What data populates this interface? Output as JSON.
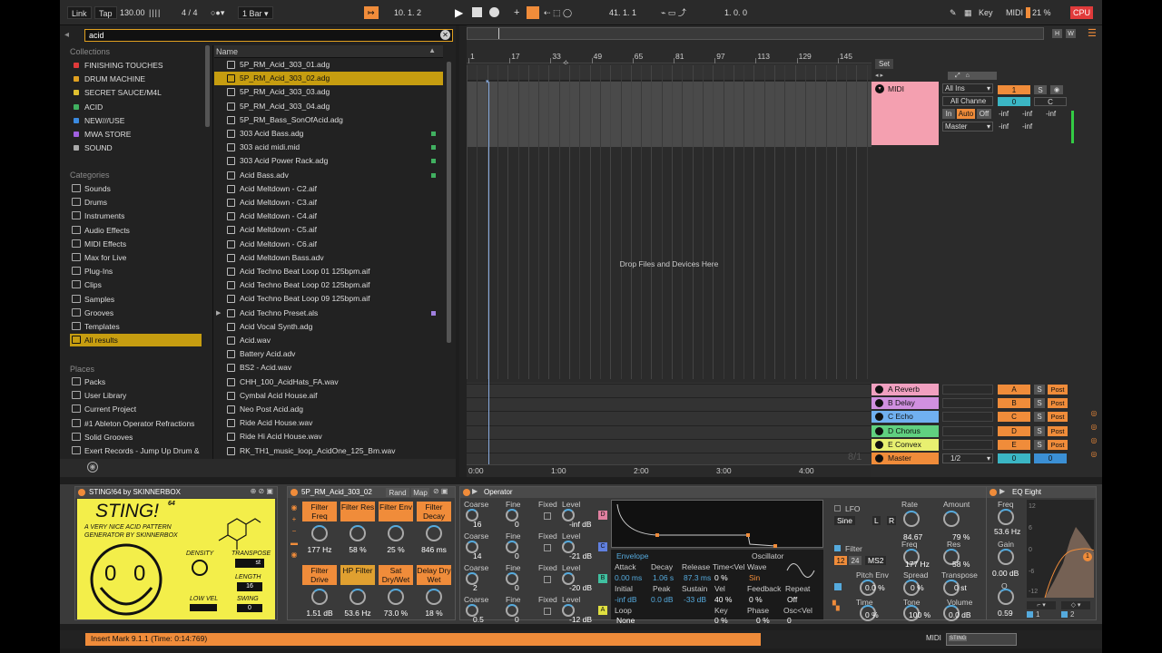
{
  "transport": {
    "link": "Link",
    "tap": "Tap",
    "tempo": "130.00",
    "signature": "4 / 4",
    "quantize": "1 Bar",
    "position": "10.  1.  2",
    "loop_start": "41.  1.  1",
    "loop_length": "1.  0.  0",
    "key": "Key",
    "midi": "MIDI",
    "cpu_value": "21 %",
    "cpu": "CPU"
  },
  "browser": {
    "search_value": "acid",
    "collections_header": "Collections",
    "collections": [
      {
        "label": "FINISHING TOUCHES",
        "color": "#e03a3a"
      },
      {
        "label": "DRUM MACHINE",
        "color": "#e0a020"
      },
      {
        "label": "SECRET SAUCE/M4L",
        "color": "#e0c030"
      },
      {
        "label": "ACID",
        "color": "#40b060"
      },
      {
        "label": "NEW///USE",
        "color": "#3a8ae0"
      },
      {
        "label": "MWA STORE",
        "color": "#a060e0"
      },
      {
        "label": "SOUND",
        "color": "#aaaaaa"
      }
    ],
    "categories_header": "Categories",
    "categories": [
      "Sounds",
      "Drums",
      "Instruments",
      "Audio Effects",
      "MIDI Effects",
      "Max for Live",
      "Plug-Ins",
      "Clips",
      "Samples",
      "Grooves",
      "Templates",
      "All results"
    ],
    "places_header": "Places",
    "places": [
      "Packs",
      "User Library",
      "Current Project",
      "#1 Ableton Operator Refractions",
      "Solid Grooves",
      "Exert Records - Jump Up Drum &"
    ],
    "column_name": "Name",
    "files": [
      {
        "name": "5P_RM_Acid_303_01.adg",
        "tag": ""
      },
      {
        "name": "5P_RM_Acid_303_02.adg",
        "tag": ""
      },
      {
        "name": "5P_RM_Acid_303_03.adg",
        "tag": ""
      },
      {
        "name": "5P_RM_Acid_303_04.adg",
        "tag": ""
      },
      {
        "name": "5P_RM_Bass_SonOfAcid.adg",
        "tag": ""
      },
      {
        "name": "303 Acid Bass.adg",
        "tag": "#40b060"
      },
      {
        "name": "303 acid midi.mid",
        "tag": "#40b060"
      },
      {
        "name": "303 Acid Power Rack.adg",
        "tag": "#40b060"
      },
      {
        "name": "Acid Bass.adv",
        "tag": "#40b060"
      },
      {
        "name": "Acid Meltdown - C2.aif",
        "tag": ""
      },
      {
        "name": "Acid Meltdown - C3.aif",
        "tag": ""
      },
      {
        "name": "Acid Meltdown - C4.aif",
        "tag": ""
      },
      {
        "name": "Acid Meltdown - C5.aif",
        "tag": ""
      },
      {
        "name": "Acid Meltdown - C6.aif",
        "tag": ""
      },
      {
        "name": "Acid Meltdown Bass.adv",
        "tag": ""
      },
      {
        "name": "Acid Techno Beat Loop 01 125bpm.aif",
        "tag": ""
      },
      {
        "name": "Acid Techno Beat Loop 02 125bpm.aif",
        "tag": ""
      },
      {
        "name": "Acid Techno Beat Loop 09 125bpm.aif",
        "tag": ""
      },
      {
        "name": "Acid Techno Preset.als",
        "tag": "#a080e0"
      },
      {
        "name": "Acid Vocal Synth.adg",
        "tag": ""
      },
      {
        "name": "Acid.wav",
        "tag": ""
      },
      {
        "name": "Battery Acid.adv",
        "tag": ""
      },
      {
        "name": "BS2 - Acid.wav",
        "tag": ""
      },
      {
        "name": "CHH_100_AcidHats_FA.wav",
        "tag": ""
      },
      {
        "name": "Cymbal Acid House.aif",
        "tag": ""
      },
      {
        "name": "Neo Post Acid.adg",
        "tag": ""
      },
      {
        "name": "Ride Acid House.wav",
        "tag": ""
      },
      {
        "name": "Ride Hi Acid House.wav",
        "tag": ""
      },
      {
        "name": "RK_TH1_music_loop_AcidOne_125_Bm.wav",
        "tag": ""
      }
    ]
  },
  "arrangement": {
    "bars": [
      "1",
      "17",
      "33",
      "49",
      "65",
      "81",
      "97",
      "113",
      "129",
      "145"
    ],
    "drop_text": "Drop Files and Devices Here",
    "set_label": "Set",
    "times": [
      "0:00",
      "1:00",
      "2:00",
      "3:00",
      "4:00"
    ],
    "zoom": "8/1"
  },
  "mixer": {
    "midi_track": {
      "name": "MIDI",
      "input": "All Ins",
      "channel": "All Channe",
      "monitor_in": "In",
      "monitor_auto": "Auto",
      "monitor_off": "Off",
      "output": "Master",
      "number": "1",
      "solo": "S",
      "volume": "0",
      "pan": "C",
      "inf1": "-inf",
      "inf2": "-inf",
      "inf3": "-inf",
      "inf4": "-inf",
      "inf5": "-inf"
    },
    "returns": [
      {
        "name": "A Reverb",
        "letter": "A",
        "color": "#f0a0c0"
      },
      {
        "name": "B Delay",
        "letter": "B",
        "color": "#d090e0"
      },
      {
        "name": "C Echo",
        "letter": "C",
        "color": "#70b0f0"
      },
      {
        "name": "D Chorus",
        "letter": "D",
        "color": "#60d080"
      },
      {
        "name": "E Convex",
        "letter": "E",
        "color": "#e8f070"
      }
    ],
    "master": {
      "name": "Master",
      "out": "1/2",
      "vol": "0",
      "pan": "0"
    },
    "solo": "S",
    "post": "Post"
  },
  "devices": {
    "sting": {
      "title": "STING!64 by SKINNERBOX",
      "logo": "STING!",
      "sup": "64",
      "tagline1": "A VERY NICE ACID PATTERN",
      "tagline2": "GENERATOR BY SKINNERBOX",
      "density": "DENSITY",
      "transpose": "TRANSPOSE",
      "transpose_val": "st",
      "length": "LENGTH",
      "length_val": "16",
      "low_vel": "LOW VEL",
      "swing": "SWING",
      "swing_val": "0"
    },
    "rack": {
      "title": "5P_RM_Acid_303_02",
      "rand": "Rand",
      "map": "Map",
      "macros": [
        {
          "label": "Filter Freq",
          "value": "177 Hz",
          "color": "#f08c3a"
        },
        {
          "label": "Filter Res",
          "value": "58 %",
          "color": "#f08c3a"
        },
        {
          "label": "Filter Env",
          "value": "25 %",
          "color": "#f08c3a"
        },
        {
          "label": "Filter Decay",
          "value": "846 ms",
          "color": "#f08c3a"
        },
        {
          "label": "Filter Drive",
          "value": "1.51 dB",
          "color": "#f08c3a"
        },
        {
          "label": "HP Filter",
          "value": "53.6 Hz",
          "color": "#e0a030"
        },
        {
          "label": "Sat Dry/Wet",
          "value": "73.0 %",
          "color": "#f08c3a"
        },
        {
          "label": "Delay Dry Wet",
          "value": "18 %",
          "color": "#f08c3a"
        }
      ]
    },
    "operator": {
      "title": "Operator",
      "col_coarse": "Coarse",
      "col_fine": "Fine",
      "col_fixed": "Fixed",
      "col_level": "Level",
      "oscs": [
        {
          "coarse": "16",
          "fine": "0",
          "level": "-inf dB",
          "letter": "D",
          "color": "#e080a0"
        },
        {
          "coarse": "14",
          "fine": "0",
          "level": "-21 dB",
          "letter": "C",
          "color": "#6080e0"
        },
        {
          "coarse": "2",
          "fine": "0",
          "level": "-20 dB",
          "letter": "B",
          "color": "#40c0a0"
        },
        {
          "coarse": "0.5",
          "fine": "0",
          "level": "-12 dB",
          "letter": "A",
          "color": "#e0e040"
        }
      ],
      "envelope": "Envelope",
      "oscillator": "Oscillator",
      "attack": "Attack",
      "attack_val": "0.00 ms",
      "decay": "Decay",
      "decay_val": "1.06 s",
      "release": "Release",
      "release_val": "87.3 ms",
      "timevel": "Time<Vel",
      "timevel_val": "0 %",
      "initial": "Initial",
      "initial_val": "-inf dB",
      "peak": "Peak",
      "peak_val": "0.0 dB",
      "sustain": "Sustain",
      "sustain_val": "-33 dB",
      "vel": "Vel",
      "vel_val": "40 %",
      "loop": "Loop",
      "loop_val": "None",
      "key": "Key",
      "key_val": "0 %",
      "wave": "Wave",
      "wave_val": "Sin",
      "feedback": "Feedback",
      "feedback_val": "0 %",
      "repeat": "Repeat",
      "repeat_val": "Off",
      "phase": "Phase",
      "phase_val": "0 %",
      "oscvel": "Osc<Vel",
      "oscvel_val": "0",
      "lfo": "LFO",
      "lfo_wave": "Sine",
      "lfo_l": "L",
      "lfo_r": "R",
      "rate": "Rate",
      "rate_val": "84.67",
      "amount": "Amount",
      "amount_val": "79 %",
      "filter": "Filter",
      "f12": "12",
      "f24": "24",
      "ms2": "MS2",
      "freq": "Freq",
      "freq_val": "177 Hz",
      "res": "Res",
      "res_val": "58 %",
      "pitch_env": "Pitch Env",
      "pitch_env_val": "0.0 %",
      "spread": "Spread",
      "spread_val": "0 %",
      "transpose": "Transpose",
      "transpose_val": "0 st",
      "time": "Time",
      "time_val": "0 %",
      "tone": "Tone",
      "tone_val": "100 %",
      "volume": "Volume",
      "volume_val": "0.0 dB"
    },
    "eq": {
      "title": "EQ Eight",
      "freq": "Freq",
      "freq_val": "53.6 Hz",
      "gain": "Gain",
      "gain_val": "0.00 dB",
      "q": "Q",
      "q_val": "0.59",
      "db12": "12",
      "db6": "6",
      "db0": "0",
      "dbm6": "-6",
      "dbm12": "-12",
      "band1": "1",
      "band2": "2"
    }
  },
  "status": {
    "message": "Insert Mark 9.1.1 (Time: 0:14:769)",
    "midi": "MIDI",
    "mini_label": "STING"
  }
}
